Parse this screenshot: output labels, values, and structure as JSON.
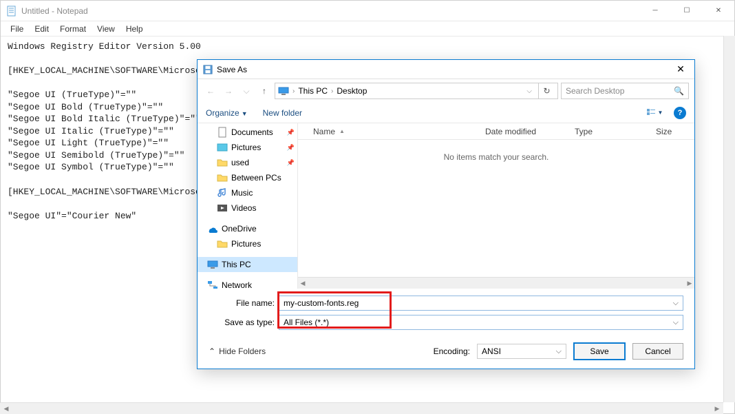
{
  "notepad": {
    "title": "Untitled - Notepad",
    "menu": {
      "file": "File",
      "edit": "Edit",
      "format": "Format",
      "view": "View",
      "help": "Help"
    },
    "content": "Windows Registry Editor Version 5.00\n\n[HKEY_LOCAL_MACHINE\\SOFTWARE\\Microsoft\n\n\"Segoe UI (TrueType)\"=\"\"\n\"Segoe UI Bold (TrueType)\"=\"\"\n\"Segoe UI Bold Italic (TrueType)\"=\"\"\n\"Segoe UI Italic (TrueType)\"=\"\"\n\"Segoe UI Light (TrueType)\"=\"\"\n\"Segoe UI Semibold (TrueType)\"=\"\"\n\"Segoe UI Symbol (TrueType)\"=\"\"\n\n[HKEY_LOCAL_MACHINE\\SOFTWARE\\Microsof\n\n\"Segoe UI\"=\"Courier New\""
  },
  "dialog": {
    "title": "Save As",
    "breadcrumb": {
      "root": "This PC",
      "folder": "Desktop"
    },
    "search_placeholder": "Search Desktop",
    "toolbar": {
      "organize": "Organize",
      "newfolder": "New folder"
    },
    "tree": {
      "documents": "Documents",
      "pictures": "Pictures",
      "used": "used",
      "between": "Between PCs",
      "music": "Music",
      "videos": "Videos",
      "onedrive": "OneDrive",
      "od_pictures": "Pictures",
      "thispc": "This PC",
      "network": "Network"
    },
    "columns": {
      "name": "Name",
      "date": "Date modified",
      "type": "Type",
      "size": "Size"
    },
    "empty_msg": "No items match your search.",
    "form": {
      "filename_lbl": "File name:",
      "filename_val": "my-custom-fonts.reg",
      "type_lbl": "Save as type:",
      "type_val": "All Files  (*.*)"
    },
    "footer": {
      "hide": "Hide Folders",
      "encoding_lbl": "Encoding:",
      "encoding_val": "ANSI",
      "save": "Save",
      "cancel": "Cancel"
    }
  }
}
